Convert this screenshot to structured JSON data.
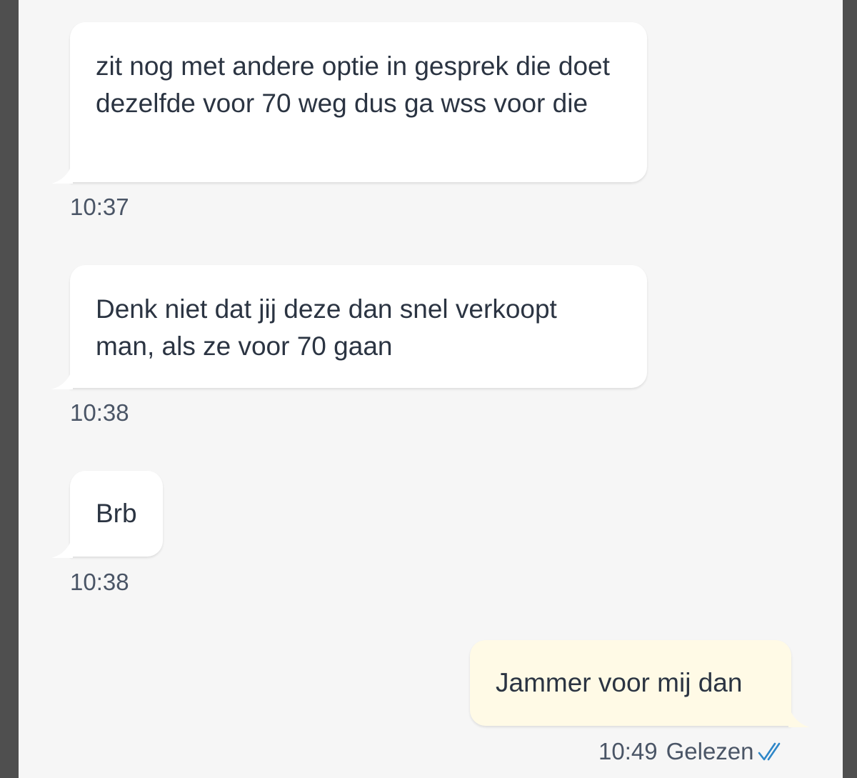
{
  "messages": [
    {
      "direction": "incoming",
      "text": "zit nog met andere optie in gesprek die doet dezelfde voor 70 weg dus ga wss voor die",
      "time": "10:37"
    },
    {
      "direction": "incoming",
      "text": "Denk niet dat jij deze dan snel verkoopt man, als ze voor 70 gaan",
      "time": "10:38"
    },
    {
      "direction": "incoming",
      "text": "Brb",
      "time": "10:38"
    },
    {
      "direction": "outgoing",
      "text": "Jammer voor mij dan",
      "time": "10:49",
      "status": "Gelezen",
      "status_icon": "double-check-icon"
    }
  ],
  "colors": {
    "incoming_bubble": "#ffffff",
    "outgoing_bubble": "#fffae6",
    "read_check": "#2f87c8",
    "background": "#f6f6f6"
  }
}
